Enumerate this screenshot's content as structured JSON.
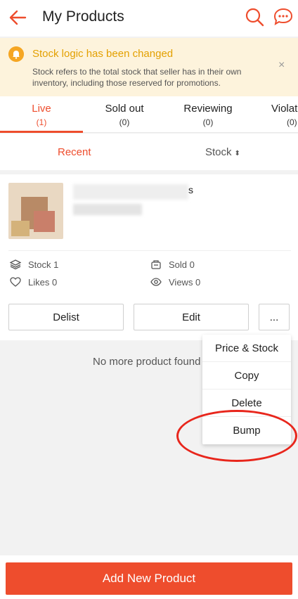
{
  "header": {
    "title": "My Products"
  },
  "notice": {
    "title": "Stock logic has been changed",
    "body": "Stock refers to the total stock that seller has in their own inventory, including those reserved for promotions.",
    "close": "×"
  },
  "tabs": [
    {
      "label": "Live",
      "count": "(1)"
    },
    {
      "label": "Sold out",
      "count": "(0)"
    },
    {
      "label": "Reviewing",
      "count": "(0)"
    },
    {
      "label": "Violat",
      "count": "(0)"
    }
  ],
  "sort": {
    "recent": "Recent",
    "stock": "Stock",
    "stock_arrow": "⬍"
  },
  "product": {
    "name_tail": "s",
    "stats": {
      "stock": "Stock 1",
      "sold": "Sold 0",
      "likes": "Likes 0",
      "views": "Views 0"
    },
    "actions": {
      "delist": "Delist",
      "edit": "Edit",
      "more": "..."
    }
  },
  "no_more": "No more product found",
  "dropdown": [
    "Price & Stock",
    "Copy",
    "Delete",
    "Bump"
  ],
  "footer": {
    "add": "Add New Product"
  },
  "colors": {
    "accent": "#ee4d2d",
    "notice_bg": "#fdf3dc",
    "notice_title": "#e3a000",
    "highlight": "#e8261c"
  }
}
